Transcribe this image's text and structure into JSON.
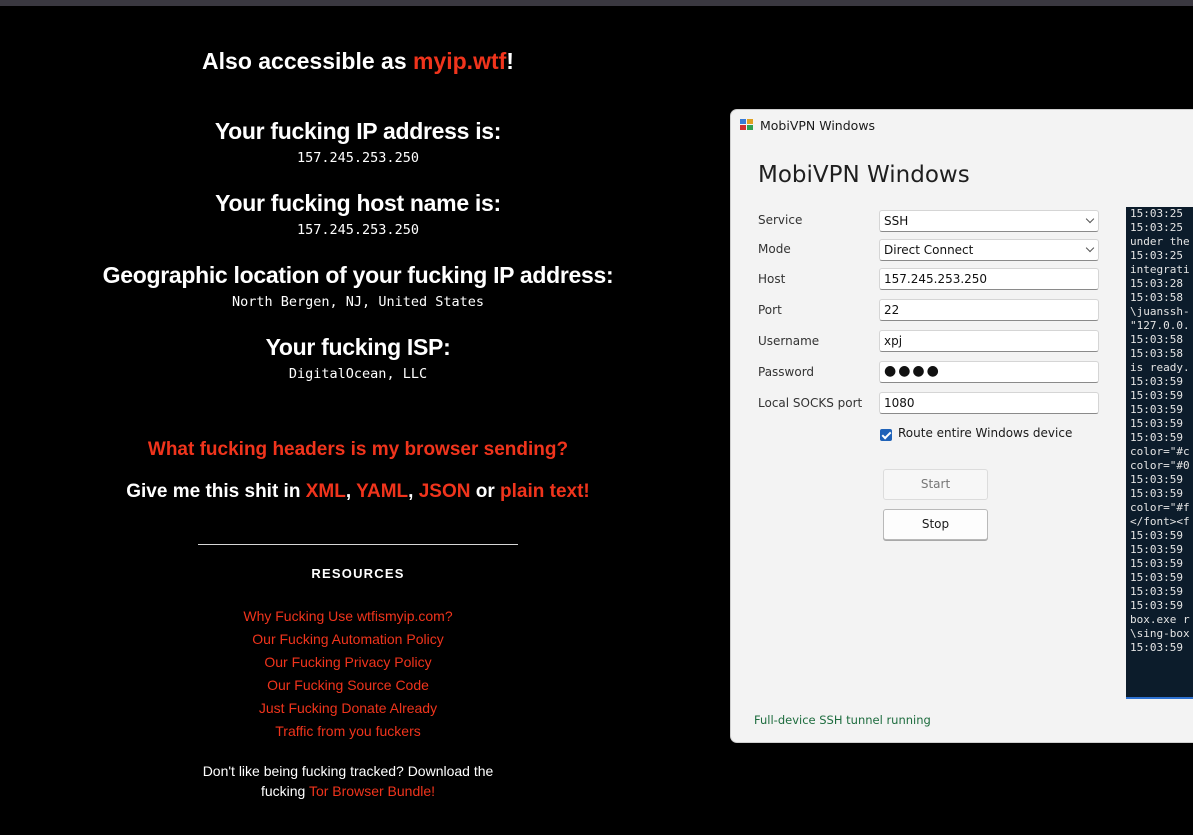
{
  "site": {
    "access_prefix": "Also accessible as ",
    "access_link": "myip.wtf",
    "access_suffix": "!",
    "ip_title": "Your fucking IP address is:",
    "ip_value": "157.245.253.250",
    "host_title": "Your fucking host name is:",
    "host_value": "157.245.253.250",
    "geo_title": "Geographic location of your fucking IP address:",
    "geo_value": "North Bergen, NJ, United States",
    "isp_title": "Your fucking ISP:",
    "isp_value": "DigitalOcean, LLC",
    "headers_link": "What fucking headers is my browser sending?",
    "formats_prefix": "Give me this shit in ",
    "format_xml": "XML",
    "sep1": ", ",
    "format_yaml": "YAML",
    "sep2": ", ",
    "format_json": "JSON",
    "sep_or": " or ",
    "format_plain": "plain text!",
    "resources_title": "RESOURCES",
    "resources": [
      "Why Fucking Use wtfismyip.com?",
      "Our Fucking Automation Policy",
      "Our Fucking Privacy Policy",
      "Our Fucking Source Code",
      "Just Fucking Donate Already",
      "Traffic from you fuckers"
    ],
    "tor_text_1": "Don't like being fucking tracked? Download the fucking ",
    "tor_link": "Tor Browser Bundle",
    "tor_text_2": "!"
  },
  "dialog": {
    "window_title": "MobiVPN Windows",
    "heading": "MobiVPN Windows",
    "service_label": "Service",
    "service_value": "SSH",
    "mode_label": "Mode",
    "mode_value": "Direct Connect",
    "host_label": "Host",
    "host_value": "157.245.253.250",
    "port_label": "Port",
    "port_value": "22",
    "username_label": "Username",
    "username_value": "xpj",
    "password_label": "Password",
    "password_mask": "●●●●",
    "socks_label": "Local SOCKS port",
    "socks_value": "1080",
    "route_label": "Route entire Windows device",
    "route_checked": true,
    "start_label": "Start",
    "stop_label": "Stop",
    "status_text": "Full-device SSH tunnel running",
    "log_lines": [
      "15:03:25",
      "15:03:25",
      "under the",
      "15:03:25",
      "integrati",
      "15:03:28",
      "15:03:58",
      "\\juanssh-",
      "\"127.0.0.",
      "15:03:58",
      "15:03:58",
      "is ready.",
      "15:03:59",
      "15:03:59",
      "15:03:59",
      "15:03:59",
      "15:03:59",
      "color=\"#c",
      "color=\"#0",
      "15:03:59",
      "15:03:59",
      "color=\"#f",
      "</font><f",
      "15:03:59",
      "15:03:59",
      "15:03:59",
      "15:03:59",
      "15:03:59",
      "15:03:59",
      "box.exe r",
      "\\sing-box",
      "15:03:59"
    ]
  },
  "colors": {
    "background": "#000000",
    "link_red": "#f0341c",
    "status_green": "#1d6c3e",
    "checkbox_blue": "#1f62b8",
    "log_background": "#0c1c2b"
  }
}
